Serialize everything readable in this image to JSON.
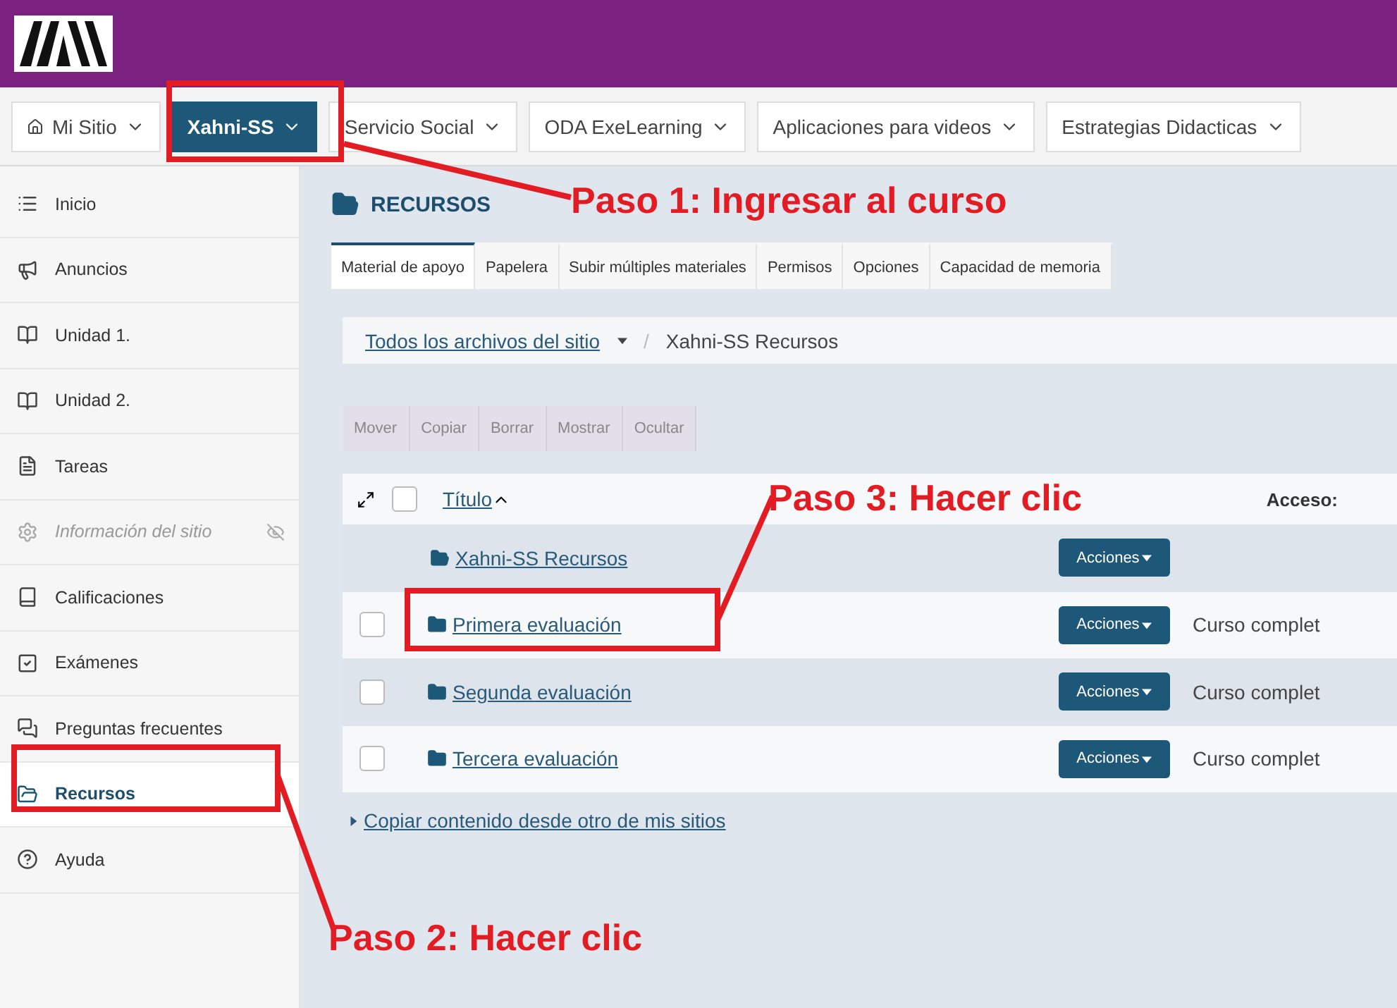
{
  "nav": [
    {
      "label": "Mi Sitio",
      "kind": "home",
      "selected": false
    },
    {
      "label": "Xahni-SS",
      "kind": "site",
      "selected": true
    },
    {
      "label": "Servicio Social",
      "kind": "site",
      "selected": false
    },
    {
      "label": "ODA ExeLearning",
      "kind": "site",
      "selected": false
    },
    {
      "label": "Aplicaciones para videos",
      "kind": "site",
      "selected": false
    },
    {
      "label": "Estrategias Didacticas",
      "kind": "site",
      "selected": false
    }
  ],
  "sidebar": [
    {
      "label": "Inicio",
      "selected": false,
      "disabled": false
    },
    {
      "label": "Anuncios",
      "selected": false,
      "disabled": false
    },
    {
      "label": "Unidad 1.",
      "selected": false,
      "disabled": false
    },
    {
      "label": "Unidad 2.",
      "selected": false,
      "disabled": false
    },
    {
      "label": "Tareas",
      "selected": false,
      "disabled": false
    },
    {
      "label": "Información del sitio",
      "selected": false,
      "disabled": true
    },
    {
      "label": "Calificaciones",
      "selected": false,
      "disabled": false
    },
    {
      "label": "Exámenes",
      "selected": false,
      "disabled": false
    },
    {
      "label": "Preguntas frecuentes",
      "selected": false,
      "disabled": false
    },
    {
      "label": "Recursos",
      "selected": true,
      "disabled": false
    },
    {
      "label": "Ayuda",
      "selected": false,
      "disabled": false
    }
  ],
  "section_title": "RECURSOS",
  "tabs": [
    {
      "label": "Material de apoyo",
      "selected": true
    },
    {
      "label": "Papelera",
      "selected": false
    },
    {
      "label": "Subir múltiples materiales",
      "selected": false
    },
    {
      "label": "Permisos",
      "selected": false
    },
    {
      "label": "Opciones",
      "selected": false
    },
    {
      "label": "Capacidad de memoria",
      "selected": false
    }
  ],
  "breadcrumb": {
    "link": "Todos los archivos del sitio",
    "separator": "/",
    "current": "Xahni-SS Recursos"
  },
  "toolbar": [
    {
      "label": "Mover",
      "disabled": true
    },
    {
      "label": "Copiar",
      "disabled": true
    },
    {
      "label": "Borrar",
      "disabled": true
    },
    {
      "label": "Mostrar",
      "disabled": true
    },
    {
      "label": "Ocultar",
      "disabled": true
    }
  ],
  "table": {
    "columns": [
      "Título",
      "Acceso:"
    ],
    "select_all_checked": false,
    "rows": [
      {
        "kind": "parent",
        "title": "Xahni-SS Recursos",
        "action": "Acciones"
      },
      {
        "kind": "folder",
        "title": "Primera evaluación",
        "action": "Acciones",
        "access": "Curso complet",
        "checked": false
      },
      {
        "kind": "folder",
        "title": "Segunda evaluación",
        "action": "Acciones",
        "access": "Curso complet",
        "checked": false
      },
      {
        "kind": "folder",
        "title": "Tercera evaluación",
        "action": "Acciones",
        "access": "Curso complet",
        "checked": false
      }
    ]
  },
  "copy_link": "Copiar contenido desde otro de mis sitios",
  "annotations": [
    "Paso 1: Ingresar al curso",
    "Paso 2: Hacer clic",
    "Paso 3: Hacer clic"
  ]
}
